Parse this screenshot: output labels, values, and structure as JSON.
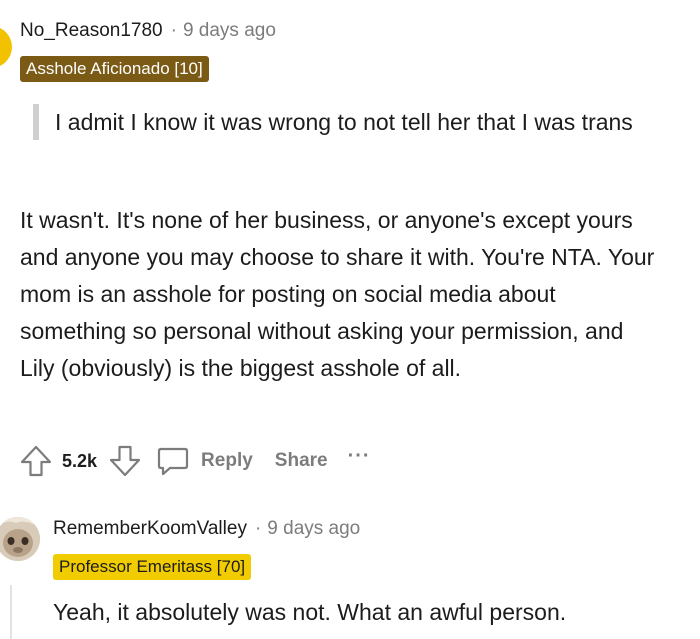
{
  "comment": {
    "username": "No_Reason1780",
    "separator": "·",
    "timestamp": "9 days ago",
    "flair": "Asshole Aficionado [10]",
    "quote": "I admit I know it was wrong to not tell her that I was trans",
    "body": "It wasn't. It's none of her business, or anyone's except yours and anyone you may choose to share it with. You're NTA. Your mom is an asshole for posting on social media about something so personal without asking your permission, and Lily (obviously) is the biggest asshole of all.",
    "actions": {
      "vote_count": "5.2k",
      "reply_label": "Reply",
      "share_label": "Share",
      "more_label": "···"
    },
    "avatar_color": "#f2c200",
    "flair_color": "#7a5a14"
  },
  "reply": {
    "username": "RememberKoomValley",
    "separator": "·",
    "timestamp": "9 days ago",
    "flair": "Professor Emeritass [70]",
    "body": "Yeah, it absolutely was not. What an awful person.",
    "flair_color": "#f1cc00"
  },
  "icons": [
    "upvote-icon",
    "downvote-icon",
    "comment-bubble-icon",
    "more-options-icon"
  ]
}
